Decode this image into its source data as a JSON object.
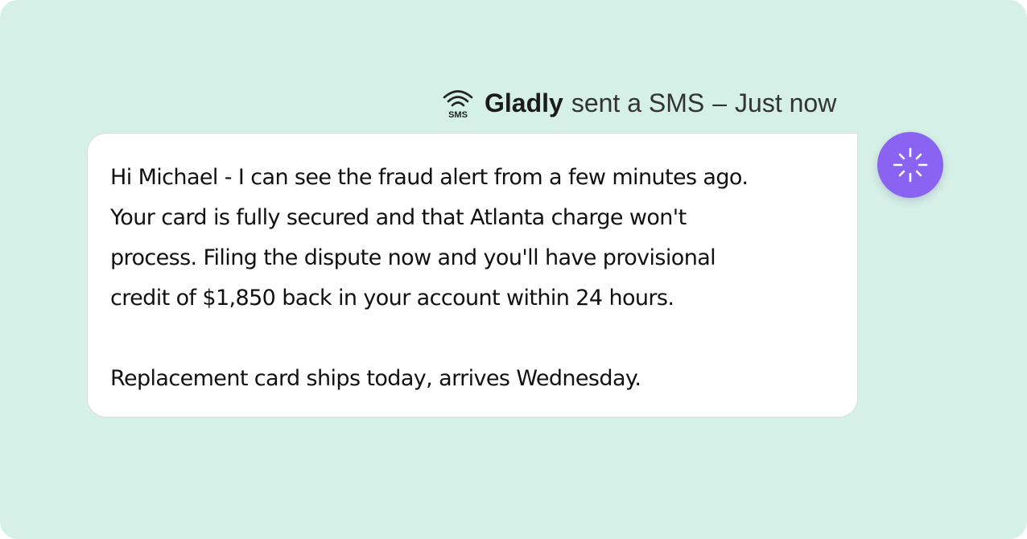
{
  "header": {
    "channel_icon": "sms-signal-icon",
    "channel_icon_label": "SMS",
    "sender": "Gladly",
    "action": "sent a SMS",
    "separator": "–",
    "timestamp": "Just now"
  },
  "message": {
    "lines": [
      "Hi Michael - I can see the fraud alert from a few minutes ago.",
      "Your card is fully secured and that Atlanta charge won't",
      "process. Filing the dispute now and you'll have provisional",
      "credit of $1,850 back in your account within 24 hours."
    ],
    "closing": "Replacement card ships today, arrives Wednesday."
  },
  "avatar": {
    "icon": "sparkle-icon",
    "color": "#8a63f2"
  },
  "colors": {
    "background": "#d5f0e6",
    "bubble": "#ffffff"
  }
}
